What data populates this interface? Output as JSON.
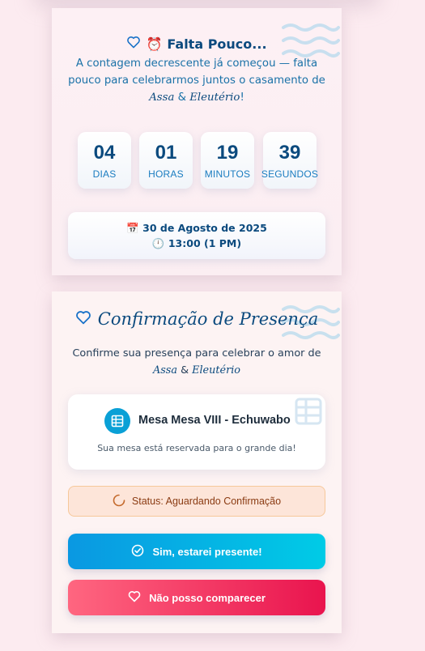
{
  "countdown_card": {
    "emoji": "⏰",
    "title": "Falta Pouco...",
    "subtitle_prefix": "A contagem decrescente já começou — falta pouco para celebrarmos juntos o casamento de",
    "name1": "Assa",
    "ampersand": "&",
    "name2": "Eleutério",
    "exclaim": "!",
    "units": [
      {
        "value": "04",
        "label": "DIAS"
      },
      {
        "value": "01",
        "label": "HORAS"
      },
      {
        "value": "19",
        "label": "MINUTOS"
      },
      {
        "value": "39",
        "label": "SEGUNDOS"
      }
    ],
    "date_emoji": "📅",
    "date": "30 de Agosto de 2025",
    "time_emoji": "🕛",
    "time": "13:00 (1 PM)"
  },
  "rsvp_card": {
    "title": "Confirmação de Presença",
    "subtitle_prefix": "Confirme sua presença para celebrar o amor de",
    "name1": "Assa",
    "ampersand": "&",
    "name2": "Eleutério",
    "table_name": "Mesa Mesa VIII - Echuwabo",
    "table_note": "Sua mesa está reservada para o grande dia!",
    "status_text": "Status: Aguardando Confirmação",
    "yes_label": "Sim, estarei presente!",
    "no_label": "Não posso comparecer"
  },
  "colors": {
    "primary_text": "#0b4a7e",
    "accent_blue": "#0aa0d6",
    "accent_red": "#e9144e",
    "status_bg": "#fde5d9"
  }
}
